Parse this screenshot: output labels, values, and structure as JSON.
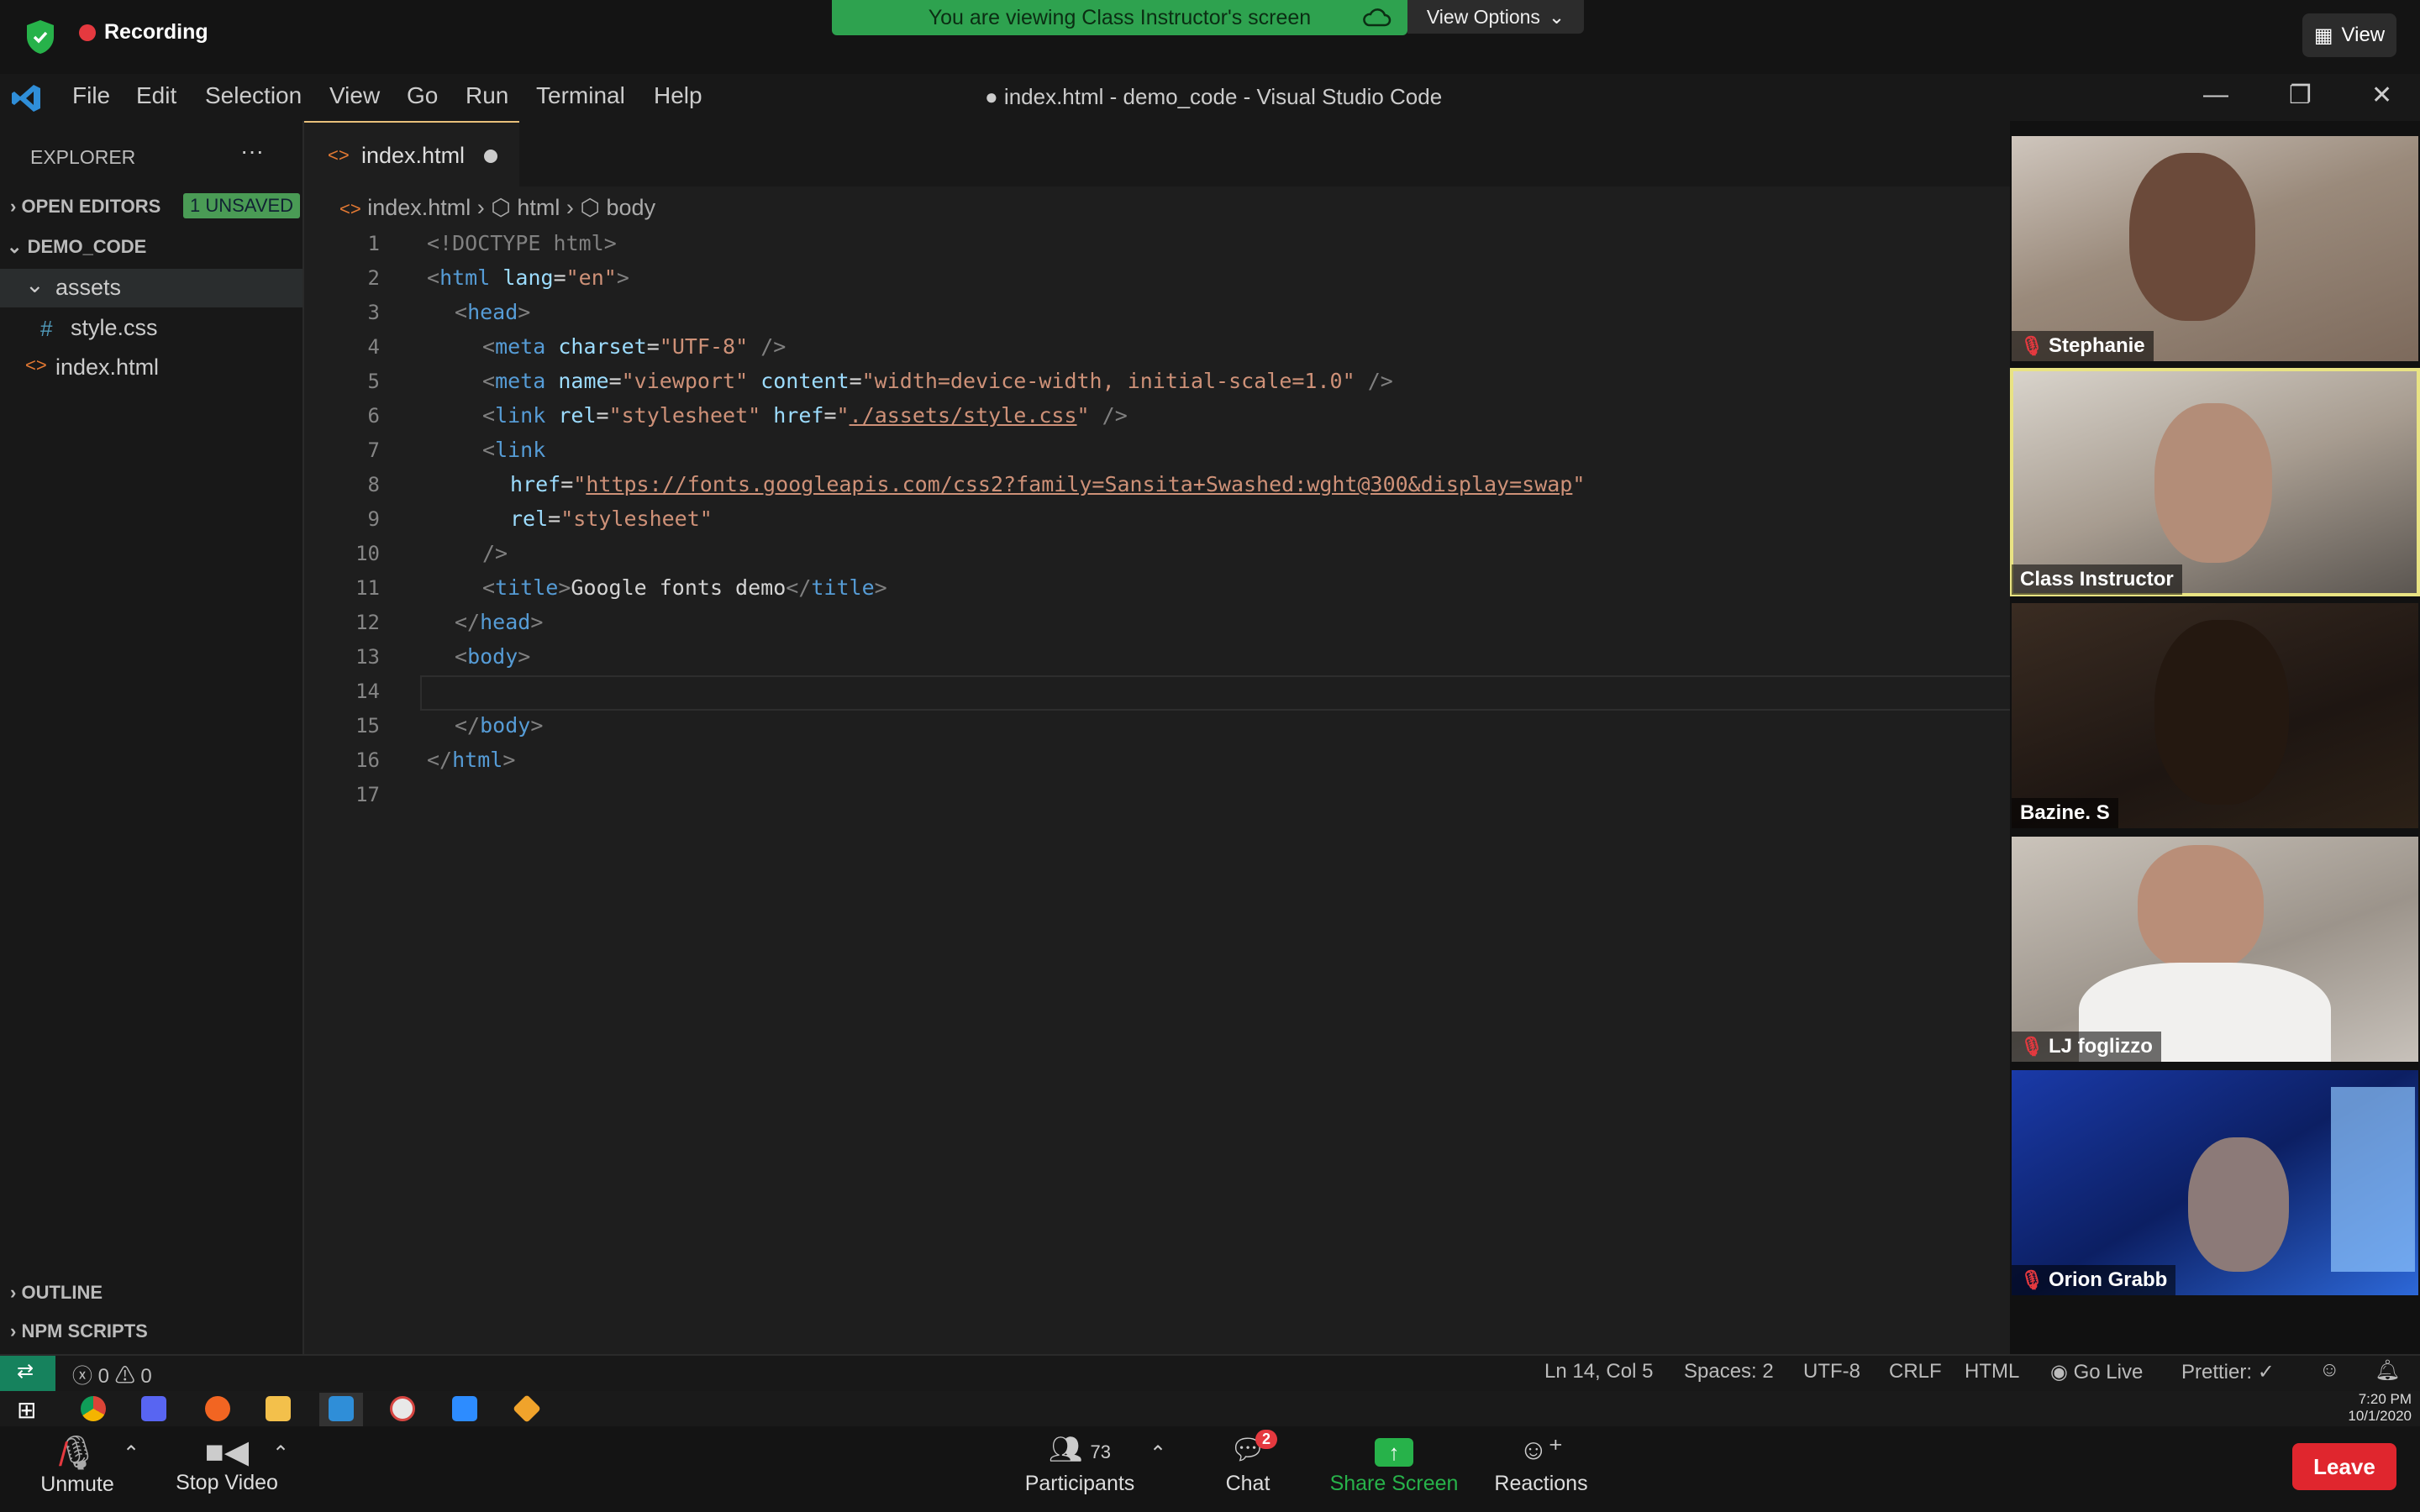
{
  "zoom": {
    "recording": "Recording",
    "viewing_banner": "You are viewing Class Instructor's screen",
    "view_options": "View Options",
    "view_button": "View",
    "participants_count": "73",
    "bottom": {
      "unmute": "Unmute",
      "stop_video": "Stop Video",
      "participants": "Participants",
      "chat": "Chat",
      "chat_badge": "2",
      "share_screen": "Share Screen",
      "reactions": "Reactions",
      "leave": "Leave"
    },
    "colors": {
      "banner": "#2ea24f",
      "leave": "#e0262e",
      "share": "#27b24a"
    }
  },
  "participants": [
    {
      "name": "Stephanie",
      "muted": true
    },
    {
      "name": "Class Instructor",
      "muted": false,
      "active": true
    },
    {
      "name": "Bazine. S",
      "muted": false
    },
    {
      "name": "LJ foglizzo",
      "muted": true
    },
    {
      "name": "Orion Grabb",
      "muted": true
    }
  ],
  "vscode": {
    "menu": [
      "File",
      "Edit",
      "Selection",
      "View",
      "Go",
      "Run",
      "Terminal",
      "Help"
    ],
    "window_title": "● index.html - demo_code - Visual Studio Code",
    "explorer": "EXPLORER",
    "explorer_more": "···",
    "open_editors": "OPEN EDITORS",
    "unsaved_badge": "1 UNSAVED",
    "project": "DEMO_CODE",
    "tree": {
      "folder": "assets",
      "css_file": "style.css",
      "html_file": "index.html"
    },
    "outline": "OUTLINE",
    "npm_scripts": "NPM SCRIPTS",
    "tab": "index.html",
    "breadcrumb": [
      "index.html",
      "html",
      "body"
    ],
    "line_numbers": [
      "1",
      "2",
      "3",
      "4",
      "5",
      "6",
      "7",
      "8",
      "9",
      "10",
      "11",
      "12",
      "13",
      "14",
      "15",
      "16",
      "17"
    ],
    "code": {
      "l1": "<!DOCTYPE html>",
      "l2_tag": "html",
      "l2_attr": "lang",
      "l2_val": "\"en\"",
      "l3": "head",
      "l4_attr": "charset",
      "l4_val": "\"UTF-8\"",
      "l5_a1": "name",
      "l5_v1": "\"viewport\"",
      "l5_a2": "content",
      "l5_v2": "\"width=device-width, initial-scale=1.0\"",
      "l6_a1": "rel",
      "l6_v1": "\"stylesheet\"",
      "l6_a2": "href",
      "l6_v2": "./assets/style.css",
      "l7": "link",
      "l8_attr": "href",
      "l8_val": "https://fonts.googleapis.com/css2?family=Sansita+Swashed:wght@300&display=swap",
      "l9_attr": "rel",
      "l9_val": "\"stylesheet\"",
      "l10": "/>",
      "l11_text": "Google fonts demo",
      "l12": "head",
      "l13": "body",
      "l15": "body",
      "l16": "html"
    },
    "status": {
      "errors": "0",
      "warnings": "0",
      "position": "Ln 14, Col 5",
      "spaces": "Spaces: 2",
      "encoding": "UTF-8",
      "eol": "CRLF",
      "language": "HTML",
      "go_live": "Go Live",
      "prettier": "Prettier: ✓"
    }
  },
  "taskbar": {
    "time": "7:20 PM",
    "date": "10/1/2020"
  }
}
